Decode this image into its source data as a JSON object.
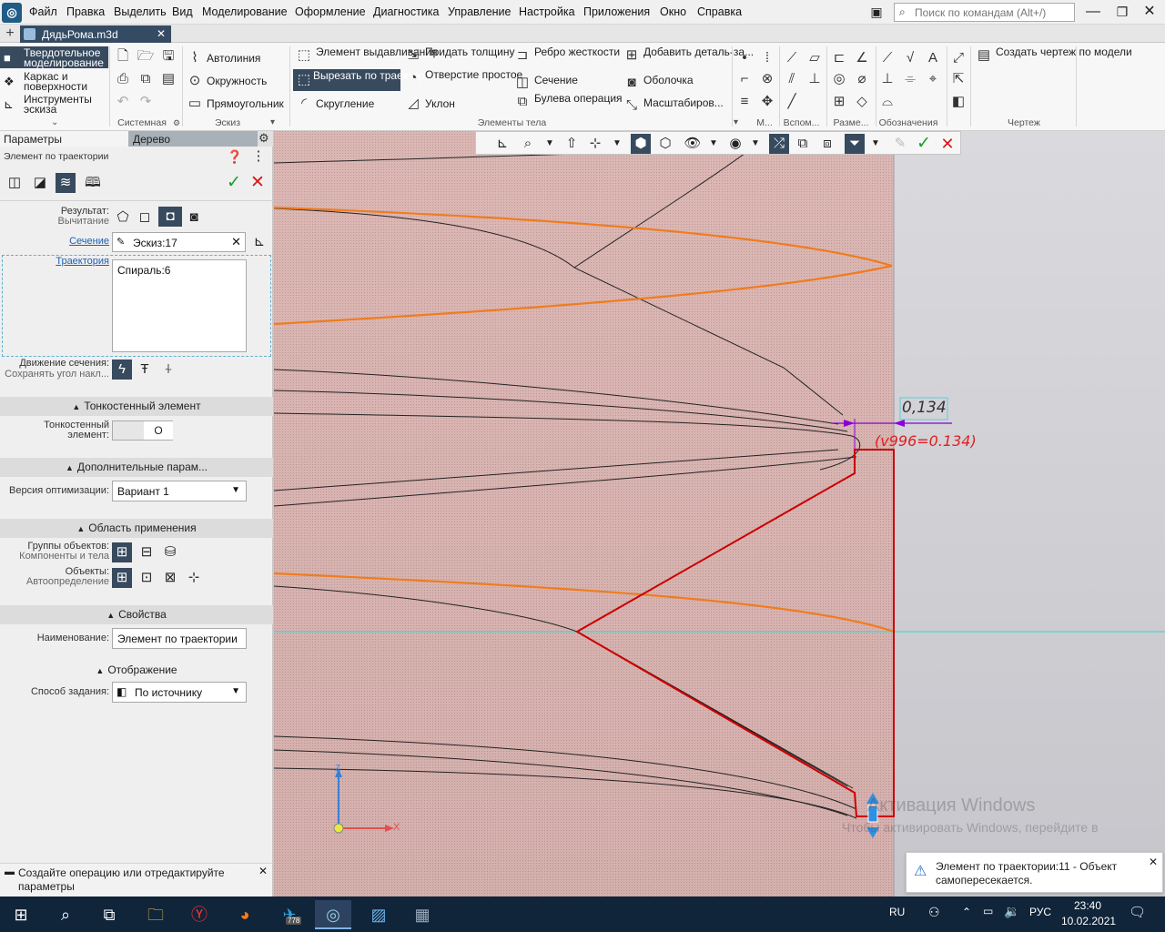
{
  "menubar": {
    "items": [
      "Файл",
      "Правка",
      "Выделить",
      "Вид",
      "Моделирование",
      "Оформление",
      "Диагностика",
      "Управление",
      "Настройка",
      "Приложения",
      "Окно",
      "Справка"
    ],
    "search_placeholder": "Поиск по командам (Alt+/)"
  },
  "tabbar": {
    "doc_tab": "ДядьРома.m3d"
  },
  "ribbon": {
    "modes": [
      "Твердотельное моделирование",
      "Каркас и поверхности",
      "Инструменты эскиза"
    ],
    "sketch": [
      "Автолиния",
      "Окружность",
      "Прямоугольник"
    ],
    "body1": [
      "Элемент выдавливания",
      "Вырезать по траектории",
      "Скругление"
    ],
    "body2": [
      "Придать толщину",
      "Отверстие простое",
      "Уклон"
    ],
    "body3": [
      "Ребро жесткости",
      "Сечение",
      "Булева операция"
    ],
    "body4": [
      "Добавить деталь-за...",
      "Оболочка",
      "Масштабиров..."
    ],
    "drawing_button": "Создать чертеж по модели",
    "groups": [
      "Системная",
      "Эскиз",
      "Элементы тела",
      "М...",
      "Вспом...",
      "Разме...",
      "Обозначения",
      "Чертеж"
    ]
  },
  "panel": {
    "tab_params": "Параметры",
    "tab_tree": "Дерево",
    "title": "Элемент по траектории",
    "result_label": "Результат:",
    "result_value": "Вычитание",
    "section_label": "Сечение",
    "section_value": "Эскиз:17",
    "trajectory_label": "Траектория",
    "trajectory_value": "Спираль:6",
    "motion_label": "Движение сечения:",
    "motion_value": "Сохранять угол накл...",
    "thin_section": "Тонкостенный элемент",
    "thin_label_1": "Тонкостенный",
    "thin_label_2": "элемент:",
    "extra_section": "Дополнительные парам...",
    "opt_label": "Версия оптимизации:",
    "opt_value": "Вариант 1",
    "scope_section": "Область применения",
    "groups_label": "Группы объектов:",
    "groups_value": "Компоненты и тела",
    "objects_label": "Объекты:",
    "objects_value": "Автоопределение",
    "props_section": "Свойства",
    "name_label": "Наименование:",
    "name_value": "Элемент по траектории",
    "display_section": "Отображение",
    "method_label": "Способ задания:",
    "method_value": "По источнику"
  },
  "status": {
    "text": "Создайте операцию или отредактируйте параметры"
  },
  "viewport": {
    "dimension_value": "0,134",
    "dimension_expr": "(v996=0.134)",
    "watermark_1": "Активация Windows",
    "watermark_2": "Чтобы активировать Windows, перейдите в",
    "axis_z": "Z",
    "axis_x": "X"
  },
  "notification": {
    "text": "Элемент по траектории:11 - Объект самопересекается."
  },
  "taskbar": {
    "lang": "RU",
    "kbd": "РУС",
    "time": "23:40",
    "date": "10.02.2021",
    "telegram_badge": "778"
  },
  "colors": {
    "accent": "#374a5e",
    "orange": "#f07c1e",
    "red": "#cc0000",
    "purple": "#8a00d4"
  }
}
